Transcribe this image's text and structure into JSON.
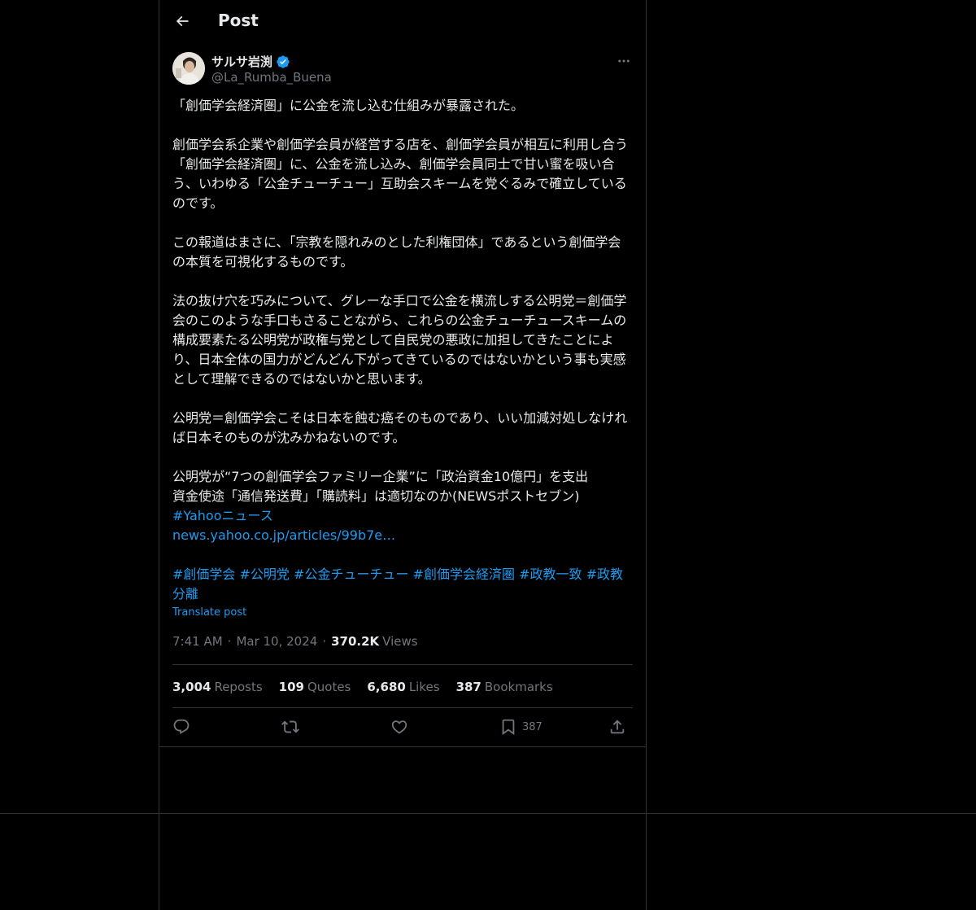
{
  "header": {
    "title": "Post"
  },
  "author": {
    "display_name": "サルサ岩渕",
    "handle": "@La_Rumba_Buena",
    "verified": true
  },
  "tweet": {
    "paragraph_1": "「創価学会経済圏」に公金を流し込む仕組みが暴露された。",
    "paragraph_2": "創価学会系企業や創価学会員が経営する店を、創価学会員が相互に利用し合う「創価学会経済圏」に、公金を流し込み、創価学会員同士で甘い蜜を吸い合う、いわゆる「公金チューチュー」互助会スキームを党ぐるみで確立しているのです。",
    "paragraph_3": "この報道はまさに、「宗教を隠れみのとした利権団体」であるという創価学会の本質を可視化するものです。",
    "paragraph_4": "法の抜け穴を巧みについて、グレーな手口で公金を横流しする公明党＝創価学会のこのような手口もさることながら、これらの公金チューチュースキームの構成要素たる公明党が政権与党として自民党の悪政に加担してきたことにより、日本全体の国力がどんどん下がってきているのではないかという事も実感として理解できるのではないかと思います。",
    "paragraph_5": "公明党＝創価学会こそは日本を蝕む癌そのものであり、いい加減対処しなければ日本そのものが沈みかねないのです。",
    "news_line_1": "公明党が“7つの創価学会ファミリー企業”に「政治資金10億円」を支出",
    "news_line_2": "資金使途「通信発送費」「購読料」は適切なのか(NEWSポストセブン)",
    "news_hashtag": "#Yahooニュース",
    "news_link": "news.yahoo.co.jp/articles/99b7e…",
    "hashtags": [
      "#創価学会",
      "#公明党",
      "#公金チューチュー",
      "#創価学会経済圏",
      "#政教一致",
      "#政教分離"
    ]
  },
  "translate_label": "Translate post",
  "meta": {
    "time": "7:41 AM",
    "date": "Mar 10, 2024",
    "views_count": "370.2K",
    "views_label": "Views"
  },
  "stats": {
    "reposts_count": "3,004",
    "reposts_label": "Reposts",
    "quotes_count": "109",
    "quotes_label": "Quotes",
    "likes_count": "6,680",
    "likes_label": "Likes",
    "bookmarks_count": "387",
    "bookmarks_label": "Bookmarks"
  },
  "actions": {
    "bookmark_count": "387"
  },
  "icons": {
    "back": "arrow-left-icon",
    "more": "more-horizontal-icon",
    "verified": "verified-badge-icon",
    "reply": "reply-icon",
    "repost": "repost-icon",
    "like": "heart-icon",
    "bookmark": "bookmark-icon",
    "share": "share-icon"
  },
  "colors": {
    "background": "#000000",
    "text": "#e7e9ea",
    "muted": "#71767b",
    "link": "#1d9bf0",
    "border": "#2f3336"
  }
}
